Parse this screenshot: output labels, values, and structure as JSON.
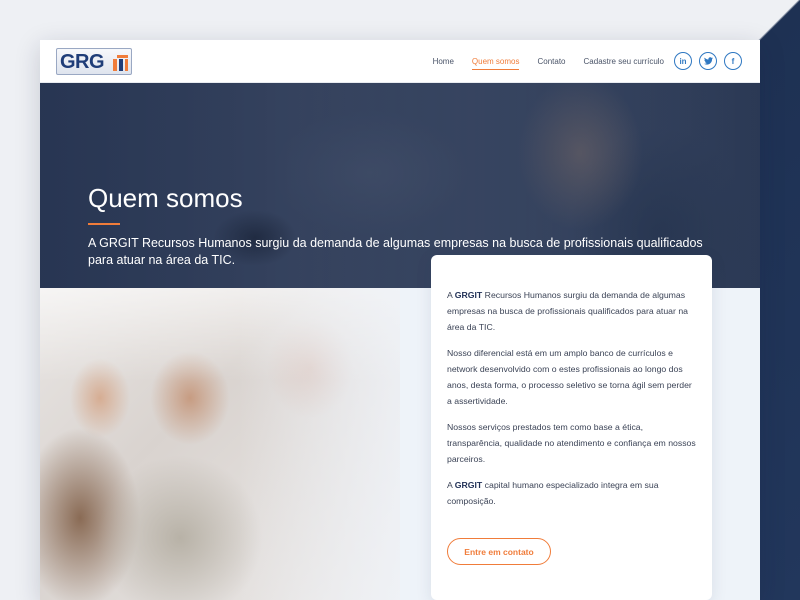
{
  "brand": {
    "logo_text": "GRG"
  },
  "nav": {
    "items": [
      {
        "label": "Home",
        "active": false
      },
      {
        "label": "Quem somos",
        "active": true
      },
      {
        "label": "Contato",
        "active": false
      },
      {
        "label": "Cadastre seu currículo",
        "active": false
      }
    ]
  },
  "social": {
    "linkedin": "in",
    "twitter": "t",
    "facebook": "f"
  },
  "hero": {
    "title": "Quem somos",
    "lead": "A GRGIT Recursos Humanos surgiu da demanda de algumas empresas na busca de profissionais qualificados para atuar na área da TIC."
  },
  "card": {
    "p1_prefix": "A ",
    "p1_brand": "GRGIT",
    "p1_rest": " Recursos Humanos surgiu da demanda de algumas empresas na busca de profissionais qualificados para atuar na área da TIC.",
    "p2": "Nosso diferencial está em um amplo banco de currículos e network desenvolvido com o estes profissionais ao longo dos anos, desta forma, o processo seletivo se torna ágil sem perder a assertividade.",
    "p3": "Nossos serviços prestados tem como base a ética, transparência, qualidade no atendimento e confiança em nossos parceiros.",
    "p4_prefix": "A ",
    "p4_brand": "GRGIT",
    "p4_rest": " capital humano especializado integra em sua composição.",
    "cta_label": "Entre em contato"
  },
  "colors": {
    "accent": "#f07c3a",
    "brand_blue": "#1f3d78",
    "social_blue": "#2f78c2",
    "navy_backdrop": "#1e3153"
  },
  "icons": [
    "logo-mark-icon",
    "linkedin-icon",
    "twitter-icon",
    "facebook-icon"
  ]
}
